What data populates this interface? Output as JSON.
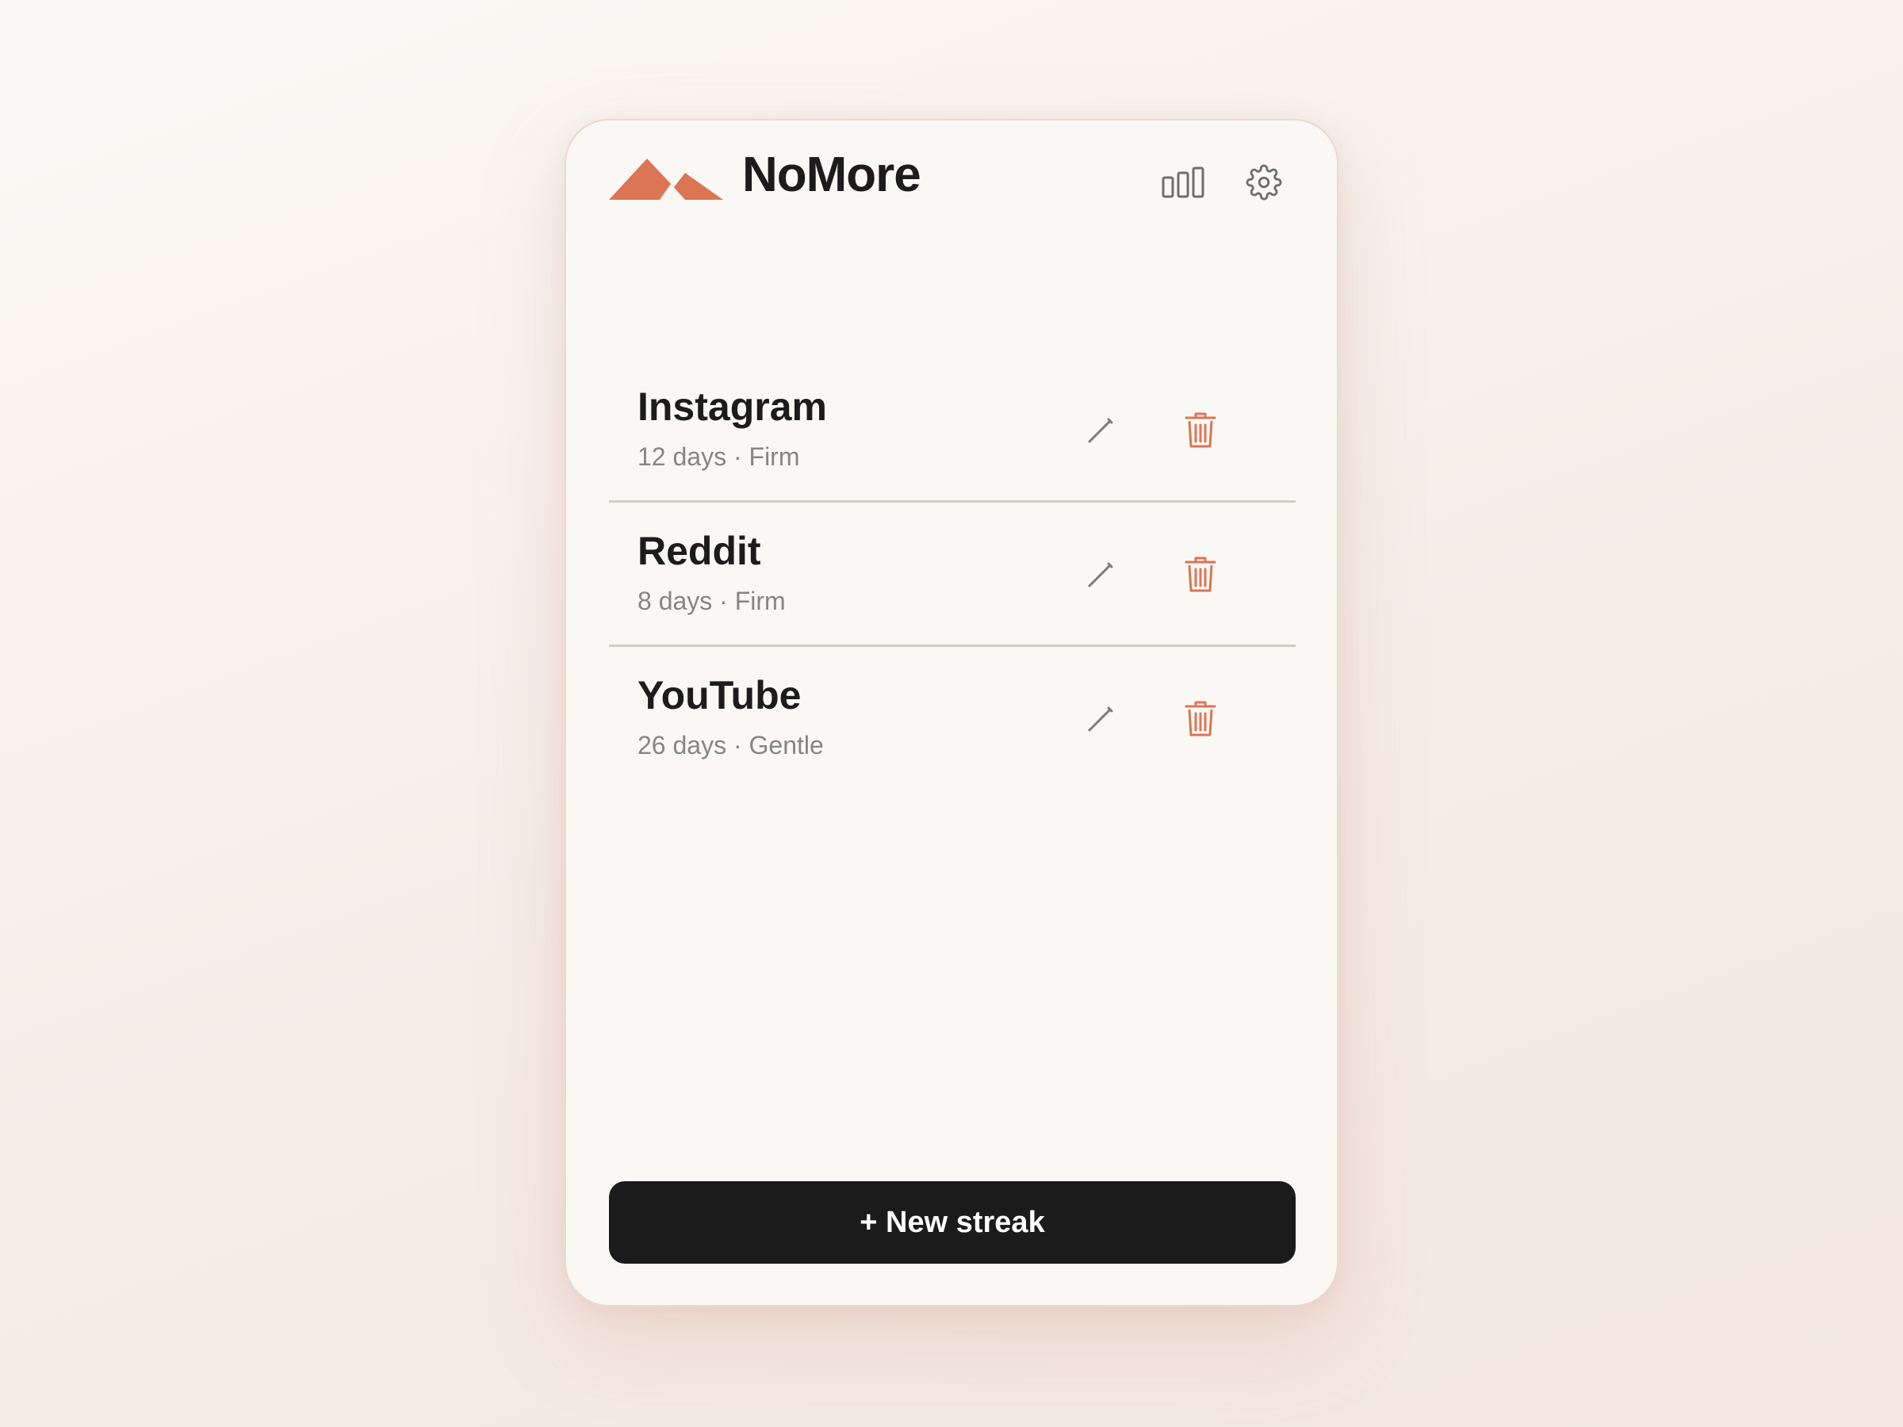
{
  "app": {
    "title": "NoMore"
  },
  "header": {
    "stats_icon": "bar-chart-icon",
    "settings_icon": "gear-icon"
  },
  "streaks": [
    {
      "name": "Instagram",
      "meta": "12 days · Firm"
    },
    {
      "name": "Reddit",
      "meta": "8 days · Firm"
    },
    {
      "name": "YouTube",
      "meta": "26 days · Gentle"
    }
  ],
  "actions": {
    "edit_icon": "pencil-icon",
    "delete_icon": "trash-icon",
    "new_streak_label": "+ New streak"
  },
  "colors": {
    "accent": "#dc7554",
    "primary_button": "#1b1b1b",
    "card_background": "#faf8f4"
  }
}
